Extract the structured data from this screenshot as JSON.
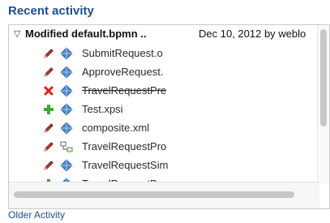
{
  "title": "Recent activity",
  "group": {
    "label": "Modified default.bpmn ..",
    "meta": "Dec 10, 2012 by weblo"
  },
  "items": [
    {
      "name": "SubmitRequest.o",
      "action": "pencil-icon",
      "object": "cube-icon",
      "deleted": false
    },
    {
      "name": "ApproveRequest.",
      "action": "pencil-icon",
      "object": "cube-icon",
      "deleted": false
    },
    {
      "name": "TravelRequestPre",
      "action": "delete-x-icon",
      "object": "cube-icon",
      "deleted": true
    },
    {
      "name": "Test.xpsi",
      "action": "plus-icon",
      "object": "cube-icon",
      "deleted": false
    },
    {
      "name": "composite.xml",
      "action": "pencil-icon",
      "object": "cube-icon",
      "deleted": false
    },
    {
      "name": "TravelRequestPro",
      "action": "pencil-icon",
      "object": "process-icon",
      "deleted": false
    },
    {
      "name": "TravelRequestSim",
      "action": "pencil-icon",
      "object": "cube-icon",
      "deleted": false
    },
    {
      "name": "TravelRequestPro",
      "action": "plus-icon",
      "object": "cube-icon",
      "deleted": false
    }
  ],
  "older_link": "Older Activity",
  "colors": {
    "title": "#1c4f8c",
    "cube": "#4a86c8",
    "pencil": "#c0392b",
    "delete": "#e0201a",
    "add": "#3ba933"
  }
}
